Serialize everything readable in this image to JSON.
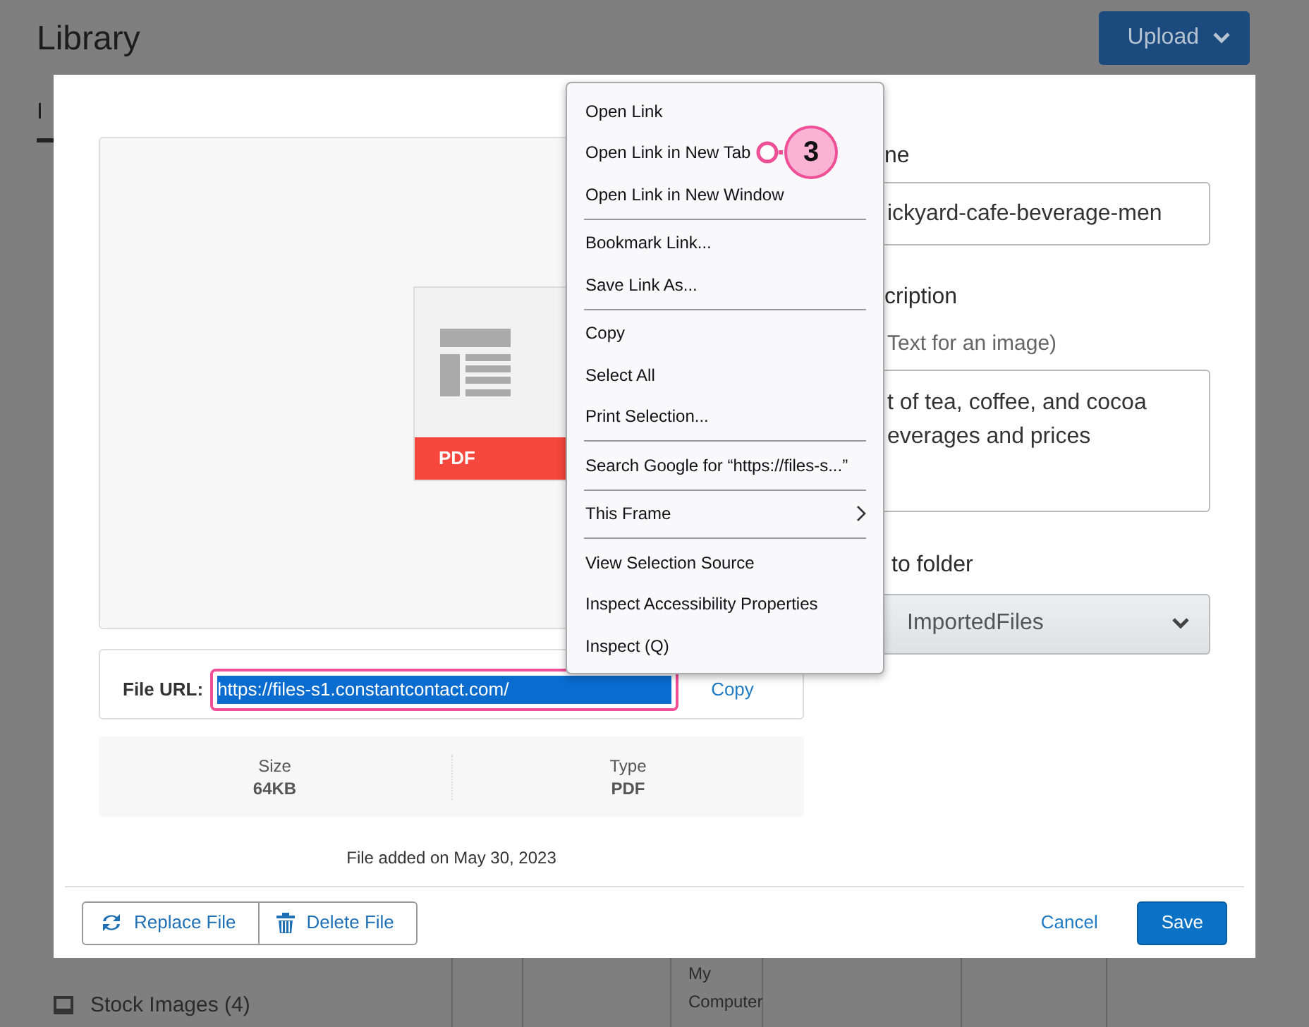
{
  "page": {
    "title": "Library",
    "upload_button": "Upload",
    "tab": "I",
    "sidebar_item": "Stock Images (4)",
    "table_cell": "My Computer"
  },
  "modal": {
    "preview": {
      "file_badge": "PDF"
    },
    "file_url": {
      "label": "File URL:",
      "value": "https://files-s1.constantcontact.com/",
      "selected": true,
      "copy": "Copy"
    },
    "details": [
      {
        "label": "Size",
        "value": "64KB"
      },
      {
        "label": "Type",
        "value": "PDF"
      }
    ],
    "added": "File added on May 30, 2023",
    "name": {
      "label": "ne",
      "value": "ickyard-cafe-beverage-men"
    },
    "description": {
      "label": "cription",
      "hint": "Text for an image)",
      "value": "t of tea, coffee, and cocoa\neverages and prices"
    },
    "folder": {
      "label": "to folder",
      "value": "ImportedFiles"
    },
    "footer": {
      "replace": "Replace File",
      "delete": "Delete File",
      "cancel": "Cancel",
      "save": "Save"
    }
  },
  "context_menu": [
    {
      "kind": "item",
      "label": "Open Link"
    },
    {
      "kind": "item",
      "label": "Open Link in New Tab"
    },
    {
      "kind": "item",
      "label": "Open Link in New Window"
    },
    {
      "kind": "separator"
    },
    {
      "kind": "item",
      "label": "Bookmark Link..."
    },
    {
      "kind": "item",
      "label": "Save Link As..."
    },
    {
      "kind": "separator"
    },
    {
      "kind": "item",
      "label": "Copy"
    },
    {
      "kind": "item",
      "label": "Select All"
    },
    {
      "kind": "item",
      "label": "Print Selection..."
    },
    {
      "kind": "separator"
    },
    {
      "kind": "item",
      "label": "Search Google for “https://files-s...”"
    },
    {
      "kind": "separator"
    },
    {
      "kind": "submenu",
      "label": "This Frame"
    },
    {
      "kind": "separator"
    },
    {
      "kind": "item",
      "label": "View Selection Source"
    },
    {
      "kind": "item",
      "label": "Inspect Accessibility Properties"
    },
    {
      "kind": "item",
      "label": "Inspect (Q)"
    }
  ],
  "callout": {
    "number": "3"
  }
}
